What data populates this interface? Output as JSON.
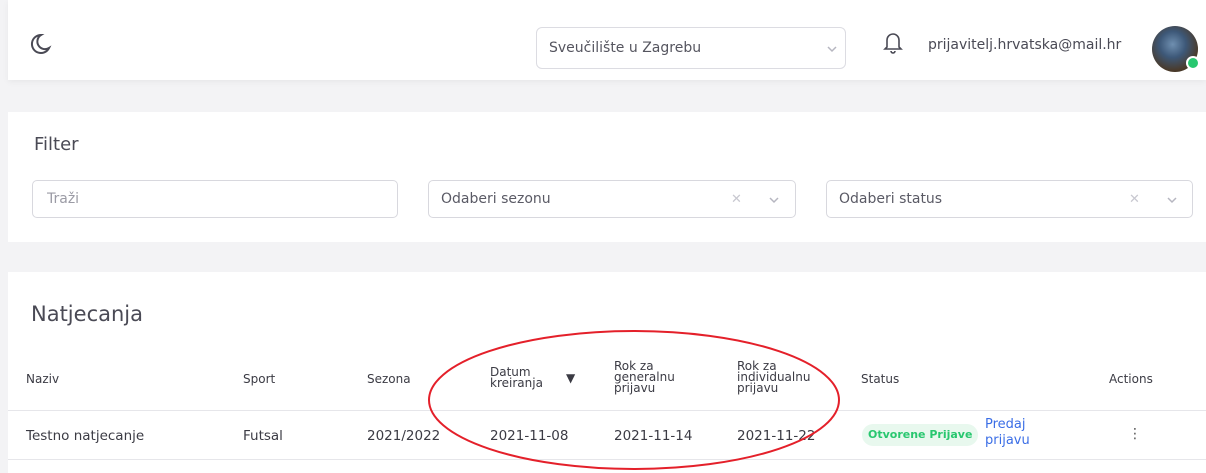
{
  "header": {
    "university": "Sveučilište u Zagrebu",
    "user_email": "prijavitelj.hrvatska@mail.hr"
  },
  "filter": {
    "title": "Filter",
    "search_placeholder": "Traži",
    "season_placeholder": "Odaberi sezonu",
    "status_placeholder": "Odaberi status"
  },
  "competitions": {
    "title": "Natjecanja",
    "columns": [
      {
        "label": "Naziv"
      },
      {
        "label": "Sport"
      },
      {
        "label": "Sezona"
      },
      {
        "label": "Datum\nkreiranja"
      },
      {
        "label": "Rok za\ngeneralnu\nprijavu"
      },
      {
        "label": "Rok za\nindividualnu\nprijavu"
      },
      {
        "label": "Status"
      },
      {
        "label": "Actions"
      }
    ],
    "sort_indicator": "▼",
    "rows": [
      {
        "name": "Testno natjecanje",
        "sport": "Futsal",
        "season": "2021/2022",
        "created": "2021-11-08",
        "general_deadline": "2021-11-14",
        "individual_deadline": "2021-11-22",
        "status": "Otvorene Prijave",
        "action_link": "Predaj\nprijavu"
      }
    ]
  },
  "colors": {
    "accent": "#3b6ee6",
    "status_green": "#28c76f",
    "annotation_red": "#e4202a"
  },
  "icons": {
    "theme_toggle": "moon-icon",
    "notifications": "bell-icon",
    "more_actions": "kebab-menu-icon"
  }
}
